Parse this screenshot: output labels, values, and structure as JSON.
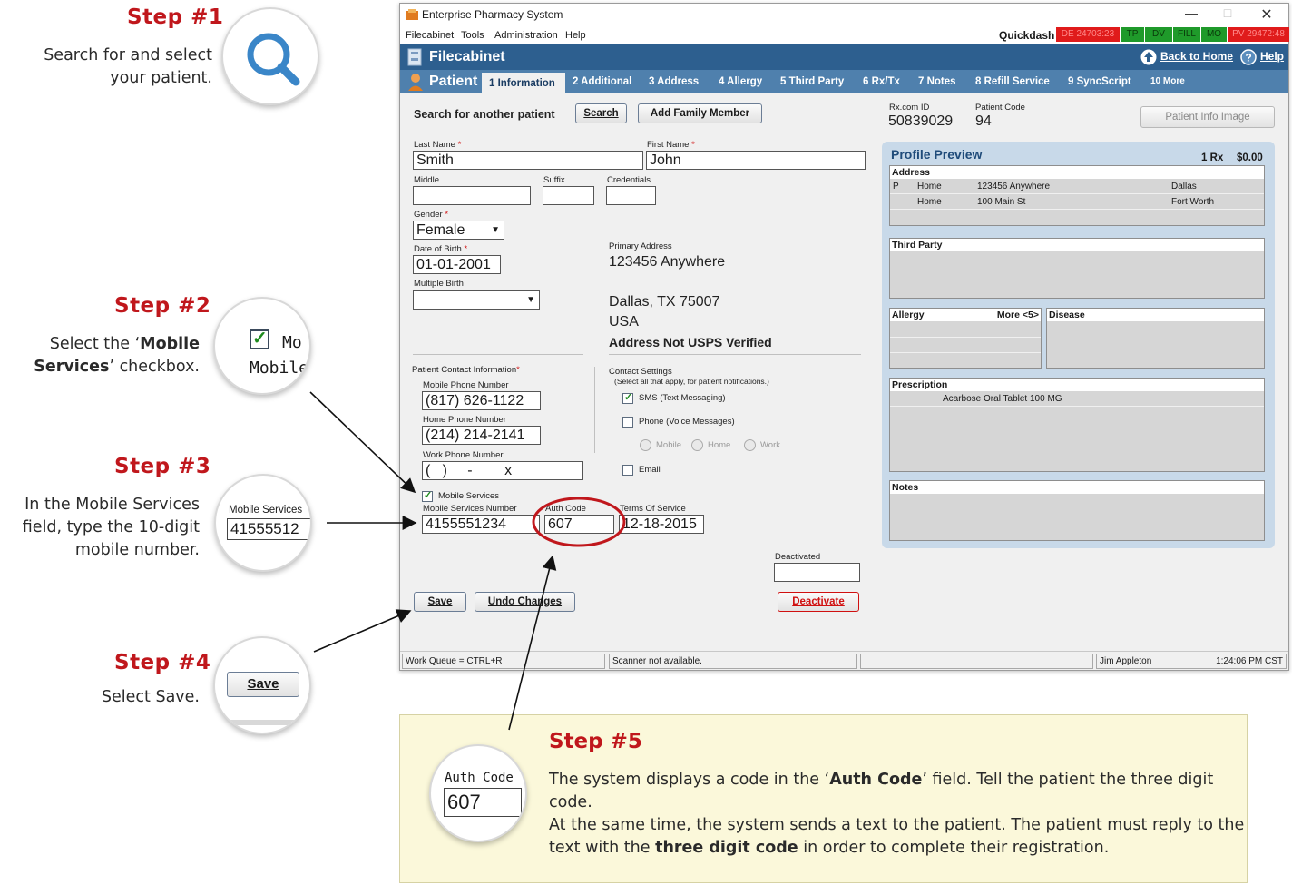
{
  "steps": {
    "s1": {
      "title": "Step #1",
      "desc": [
        "Search for and select",
        "your patient."
      ]
    },
    "s2": {
      "title": "Step #2",
      "desc_pre": "Select the ‘",
      "desc_bold1": "Mobile",
      "desc_bold2": "Services",
      "desc_post": "’ checkbox.",
      "zoom_text1": "Mo",
      "zoom_text2": "Mobile"
    },
    "s3": {
      "title": "Step #3",
      "desc": [
        "In the Mobile Services",
        "field, type the 10-digit",
        "mobile number."
      ],
      "zoom_label": "Mobile Services",
      "zoom_value": "41555512"
    },
    "s4": {
      "title": "Step #4",
      "desc": "Select Save.",
      "zoom_button": "Save"
    },
    "s5": {
      "title": "Step #5",
      "p1_pre": "The system displays a code in the ‘",
      "p1_bold": "Auth Code",
      "p1_post": "’ field. Tell the patient the three digit code.",
      "p2_line1": "At the same time, the system sends a text to the patient. The patient must reply to the",
      "p2_pre": "text with the ",
      "p2_bold": "three digit code",
      "p2_post": " in order to complete their registration.",
      "zoom_label": "Auth Code",
      "zoom_value": "607"
    }
  },
  "window": {
    "title": "Enterprise Pharmacy System",
    "menu": [
      "Filecabinet",
      "Tools",
      "Administration",
      "Help"
    ],
    "quickdash": {
      "label": "Quickdash",
      "cells": [
        {
          "text": "DE 24703:23",
          "bg": "#e01b1b",
          "fg": "#ff8a8a"
        },
        {
          "text": "TP",
          "bg": "#1f9a2a",
          "fg": "#0a3a0a"
        },
        {
          "text": "DV",
          "bg": "#1f9a2a",
          "fg": "#0a3a0a"
        },
        {
          "text": "FILL",
          "bg": "#1f9a2a",
          "fg": "#0a3a0a"
        },
        {
          "text": "MO",
          "bg": "#1f9a2a",
          "fg": "#0a3a0a"
        },
        {
          "text": "PV 29472:48",
          "bg": "#e01b1b",
          "fg": "#ff8a8a"
        }
      ]
    },
    "header": {
      "title": "Filecabinet",
      "back_home": "Back to Home",
      "help": "Help"
    },
    "tabs": {
      "patient": "Patient",
      "items": [
        "1 Information",
        "2 Additional",
        "3 Address",
        "4 Allergy",
        "5 Third Party",
        "6 Rx/Tx",
        "7 Notes",
        "8 Refill Service",
        "9 SyncScript",
        "10 More"
      ]
    },
    "search": {
      "label": "Search for another patient",
      "search_btn": "Search",
      "add_family_btn": "Add Family Member"
    },
    "ids": {
      "rx_label": "Rx.com ID",
      "rx_value": "50839029",
      "pc_label": "Patient Code",
      "pc_value": "94",
      "image_btn": "Patient Info Image"
    },
    "form": {
      "last_name_label": "Last Name",
      "last_name": "Smith",
      "first_name_label": "First Name",
      "first_name": "John",
      "middle_label": "Middle",
      "suffix_label": "Suffix",
      "credentials_label": "Credentials",
      "gender_label": "Gender",
      "gender": "Female",
      "dob_label": "Date of Birth",
      "dob": "01-01-2001",
      "multiple_birth_label": "Multiple Birth",
      "required_mark": "*"
    },
    "address": {
      "label": "Primary Address",
      "line1": "123456 Anywhere",
      "line2": "Dallas, TX 75007",
      "line3": "USA",
      "status": "Address Not USPS Verified"
    },
    "contact": {
      "label": "Patient Contact Information",
      "mobile_label": "Mobile Phone Number",
      "mobile": "(817) 626-1122",
      "home_label": "Home Phone Number",
      "home": "(214) 214-2141",
      "work_label": "Work Phone Number",
      "work": "(   )     -        x"
    },
    "settings": {
      "label": "Contact Settings",
      "sub": "(Select all that apply, for patient notifications.)",
      "sms": "SMS (Text Messaging)",
      "phone": "Phone (Voice Messages)",
      "radio_mobile": "Mobile",
      "radio_home": "Home",
      "radio_work": "Work",
      "email": "Email"
    },
    "mobile_services": {
      "checkbox_label": "Mobile Services",
      "number_label": "Mobile Services Number",
      "number": "4155551234",
      "auth_label": "Auth Code",
      "auth": "607",
      "terms_label": "Terms Of Service",
      "terms": "12-18-2015",
      "deactivated_label": "Deactivated"
    },
    "buttons": {
      "save": "Save",
      "undo": "Undo Changes",
      "deactivate": "Deactivate"
    },
    "preview": {
      "title": "Profile Preview",
      "rx_count": "1 Rx",
      "balance": "$0.00",
      "address_header": "Address",
      "address_rows": [
        {
          "c1": "P",
          "c2": "Home",
          "c3": "123456 Anywhere",
          "c4": "Dallas"
        },
        {
          "c1": "",
          "c2": "Home",
          "c3": "100 Main St",
          "c4": "Fort Worth"
        }
      ],
      "third_party_header": "Third Party",
      "allergy_header": "Allergy",
      "allergy_more": "More <5>",
      "disease_header": "Disease",
      "prescription_header": "Prescription",
      "prescription_item": "Acarbose Oral Tablet 100 MG",
      "notes_header": "Notes"
    },
    "status": {
      "queue": "Work Queue = CTRL+R",
      "scanner": "Scanner not available.",
      "user": "Jim Appleton",
      "time": "1:24:06 PM CST"
    }
  },
  "colors": {
    "accent_red": "#c0171c",
    "header_blue": "#2d5f8f",
    "tab_blue": "#4f80ad",
    "panel_yellow": "#fbf8da"
  }
}
